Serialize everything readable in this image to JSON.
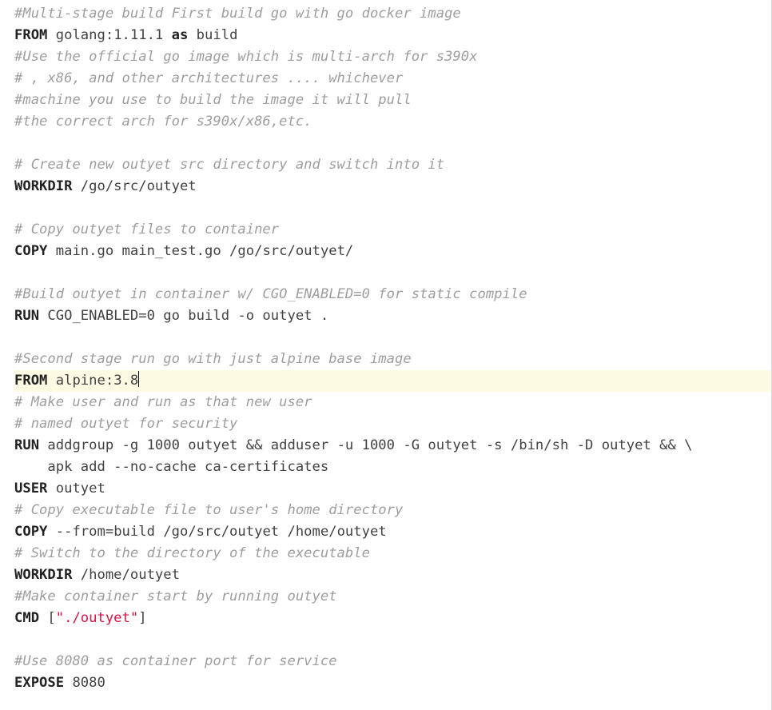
{
  "dockerfile": {
    "cursor_line_index": 18,
    "lines": [
      {
        "hl": false,
        "tokens": [
          {
            "t": "#Multi-stage build First build go with go docker image",
            "c": "comment"
          }
        ]
      },
      {
        "hl": false,
        "tokens": [
          {
            "t": "FROM",
            "c": "keyword"
          },
          {
            "t": " golang:1.11.1 ",
            "c": "text"
          },
          {
            "t": "as",
            "c": "keyword"
          },
          {
            "t": " build",
            "c": "text"
          }
        ]
      },
      {
        "hl": false,
        "tokens": [
          {
            "t": "#Use the official go image which is multi-arch for s390x",
            "c": "comment"
          }
        ]
      },
      {
        "hl": false,
        "tokens": [
          {
            "t": "# , x86, and other architectures .... whichever",
            "c": "comment"
          }
        ]
      },
      {
        "hl": false,
        "tokens": [
          {
            "t": "#machine you use to build the image it will pull",
            "c": "comment"
          }
        ]
      },
      {
        "hl": false,
        "tokens": [
          {
            "t": "#the correct arch for s390x/x86,etc.",
            "c": "comment"
          }
        ]
      },
      {
        "hl": false,
        "tokens": []
      },
      {
        "hl": false,
        "tokens": [
          {
            "t": "# Create new outyet src directory and switch into it",
            "c": "comment"
          }
        ]
      },
      {
        "hl": false,
        "tokens": [
          {
            "t": "WORKDIR",
            "c": "keyword"
          },
          {
            "t": " /go/src/outyet",
            "c": "text"
          }
        ]
      },
      {
        "hl": false,
        "tokens": []
      },
      {
        "hl": false,
        "tokens": [
          {
            "t": "# Copy outyet files to container",
            "c": "comment"
          }
        ]
      },
      {
        "hl": false,
        "tokens": [
          {
            "t": "COPY",
            "c": "keyword"
          },
          {
            "t": " main.go main_test.go /go/src/outyet/",
            "c": "text"
          }
        ]
      },
      {
        "hl": false,
        "tokens": []
      },
      {
        "hl": false,
        "tokens": [
          {
            "t": "#Build outyet in container w/ CGO_ENABLED=0 for static compile",
            "c": "comment"
          }
        ]
      },
      {
        "hl": false,
        "tokens": [
          {
            "t": "RUN",
            "c": "keyword"
          },
          {
            "t": " CGO_ENABLED=0 go build -o outyet .",
            "c": "text"
          }
        ]
      },
      {
        "hl": false,
        "tokens": []
      },
      {
        "hl": false,
        "tokens": [
          {
            "t": "#Second stage run go with just alpine base image",
            "c": "comment"
          }
        ]
      },
      {
        "hl": true,
        "tokens": [
          {
            "t": "FROM",
            "c": "keyword"
          },
          {
            "t": " alpine:3.8",
            "c": "text"
          },
          {
            "t": "__CARET__",
            "c": "caret"
          }
        ]
      },
      {
        "hl": false,
        "tokens": [
          {
            "t": "# Make user and run as that new user",
            "c": "comment"
          }
        ]
      },
      {
        "hl": false,
        "tokens": [
          {
            "t": "# named outyet for security",
            "c": "comment"
          }
        ]
      },
      {
        "hl": false,
        "tokens": [
          {
            "t": "RUN",
            "c": "keyword"
          },
          {
            "t": " addgroup -g 1000 outyet && adduser -u 1000 -G outyet -s /bin/sh -D outyet && \\",
            "c": "text"
          }
        ]
      },
      {
        "hl": false,
        "tokens": [
          {
            "t": "    apk add --no-cache ca-certificates",
            "c": "text"
          }
        ]
      },
      {
        "hl": false,
        "tokens": [
          {
            "t": "USER",
            "c": "keyword"
          },
          {
            "t": " outyet",
            "c": "text"
          }
        ]
      },
      {
        "hl": false,
        "tokens": [
          {
            "t": "# Copy executable file to user's home directory",
            "c": "comment"
          }
        ]
      },
      {
        "hl": false,
        "tokens": [
          {
            "t": "COPY",
            "c": "keyword"
          },
          {
            "t": " --from=build /go/src/outyet /home/outyet",
            "c": "text"
          }
        ]
      },
      {
        "hl": false,
        "tokens": [
          {
            "t": "# Switch to the directory of the executable",
            "c": "comment"
          }
        ]
      },
      {
        "hl": false,
        "tokens": [
          {
            "t": "WORKDIR",
            "c": "keyword"
          },
          {
            "t": " /home/outyet",
            "c": "text"
          }
        ]
      },
      {
        "hl": false,
        "tokens": [
          {
            "t": "#Make container start by running outyet",
            "c": "comment"
          }
        ]
      },
      {
        "hl": false,
        "tokens": [
          {
            "t": "CMD",
            "c": "keyword"
          },
          {
            "t": " [",
            "c": "punct"
          },
          {
            "t": "\"./outyet\"",
            "c": "string"
          },
          {
            "t": "]",
            "c": "punct"
          }
        ]
      },
      {
        "hl": false,
        "tokens": []
      },
      {
        "hl": false,
        "tokens": [
          {
            "t": "#Use 8080 as container port for service",
            "c": "comment"
          }
        ]
      },
      {
        "hl": false,
        "tokens": [
          {
            "t": "EXPOSE",
            "c": "keyword"
          },
          {
            "t": " 8080",
            "c": "text"
          }
        ]
      }
    ]
  }
}
